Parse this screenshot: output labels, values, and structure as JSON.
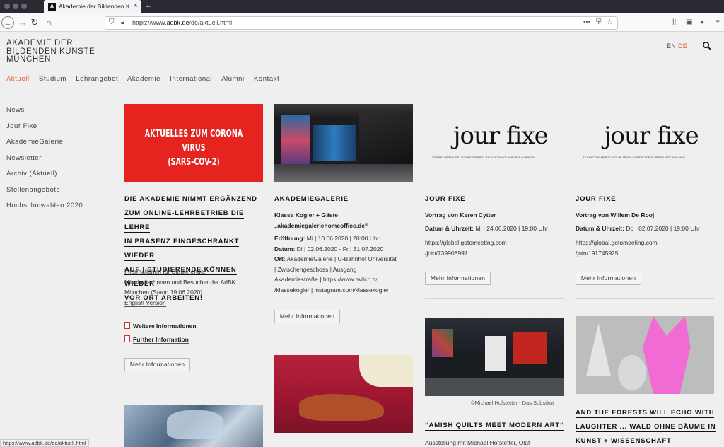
{
  "browser": {
    "tab_title": "Akademie der Bildenden Künste",
    "url_scheme": "https://www.",
    "url_domain": "adbk.de",
    "url_path": "/de/aktuell.html",
    "status_url": "https://www.adbk.de/de/aktuell.html"
  },
  "site": {
    "logo_lines": [
      "AKADEMIE DER",
      "BILDENDEN KÜNSTE",
      "MÜNCHEN"
    ],
    "lang_en": "EN",
    "lang_de": "DE"
  },
  "main_nav": [
    "Aktuell",
    "Studium",
    "Lehrangebot",
    "Akademie",
    "International",
    "Alumni",
    "Kontakt"
  ],
  "side_nav": [
    "News",
    "Jour Fixe",
    "AkademieGalerie",
    "Newsletter",
    "Archiv (Aktuell)",
    "Stellenangebote",
    "Hochschulwahlen 2020"
  ],
  "cards": {
    "corona": {
      "banner_line1": "AKTUELLES ZUM CORONA VIRUS",
      "banner_line2": "(SARS-COV-2)",
      "heading_lines": [
        "DIE AKADEMIE NIMMT ERGÄNZEND",
        "ZUM ONLINE-LEHRBETRIEB DIE LEHRE",
        "IN PRÄSENZ EINGESCHRÄNKT WIEDER",
        "AUF | STUDIERENDE KÖNNEN WIEDER",
        "VOR ORT ARBEITEN!"
      ],
      "text_lines": [
        "Informationen für Studierende,",
        "Mitarbeiter*innen und Besucher der AdBK",
        "München (Stand 19.06.2020)"
      ],
      "english_link": "English Version",
      "link1": "Weitere Informationen",
      "link2": "Further Information",
      "button": "Mehr Informationen"
    },
    "galerie": {
      "heading": "AKADEMIEGALERIE",
      "subtitle1": "Klasse Kogler + Gäste",
      "subtitle2": "„akademiegaleriehomeoffice.de“",
      "eroeffnung_label": "Eröffnung:",
      "eroeffnung_value": " Mi | 10.06.2020 | 20:00 Uhr",
      "datum_label": "Datum:",
      "datum_value": " Di | 02.06.2020 - Fr | 31.07.2020",
      "ort_label": "Ort:",
      "ort_value1": " AkademieGalerie | U-Bahnhof Universität",
      "ort_value2": "| Zwischengeschoss | Ausgang",
      "ort_value3": "Akademiestraße | https://www.twitch.tv",
      "ort_value4": "/klassekogler | instagram.com/klassekogler",
      "button": "Mehr Informationen"
    },
    "jourfixe1": {
      "logo": "jour fixe",
      "logo_sub": "STUDENT ORGANIZED LECTURE SERIES AT THE ACADEMY OF FINE ARTS IN MUNICH",
      "heading": "JOUR FIXE",
      "lecture": "Vortrag von Keren Cytter",
      "datum_label": "Datum & Uhrzeit:",
      "datum_value": " Mi | 24.06.2020 | 19:00 Uhr",
      "link1": "https://global.gotomeeting.com",
      "link2": "/join/739908997",
      "button": "Mehr Informationen"
    },
    "jourfixe2": {
      "logo": "jour fixe",
      "logo_sub": "STUDENT ORGANIZED LECTURE SERIES AT THE ACADEMY OF FINE ARTS IN MUNICH",
      "heading": "JOUR FIXE",
      "lecture": "Vortrag von Willem De Rooj",
      "datum_label": "Datum & Uhrzeit:",
      "datum_value": " Do | 02.07.2020 | 19:00 Uhr",
      "link1": " https://global.gotomeeting.com",
      "link2": "/join/191745925",
      "button": "Mehr Informationen"
    },
    "amish": {
      "caption": "©Michael Hofstetter - Das Substitut",
      "heading": "“AMISH QUILTS MEET MODERN ART“",
      "text": "Ausstellung mit Michael Hofstetter, Olaf"
    },
    "forests": {
      "heading_lines": [
        "AND THE FORESTS WILL ECHO WITH",
        "LAUGHTER ... WALD OHNE BÄUME IN",
        "KUNST + WISSENSCHAFT"
      ]
    }
  },
  "colors": {
    "accent": "#e5532b",
    "corona_red": "#e5231f"
  }
}
